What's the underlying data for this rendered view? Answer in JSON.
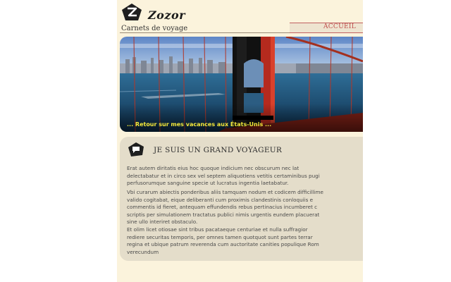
{
  "header": {
    "site_name": "Zozor",
    "tagline": "Carnets de voyage",
    "nav_home": "ACCUEIL",
    "logo_icon": "zozor-logo-icon"
  },
  "banner": {
    "caption": "... Retour sur mes vacances aux États-Unis ..."
  },
  "article": {
    "title": "JE SUIS UN GRAND VOYAGEUR",
    "icon": "speech-bubble-icon",
    "paragraphs": [
      [
        "Erat autem diritatis eius hoc quoque indicium nec obscurum nec lat",
        "delectabatur et in circo sex vel septem aliquotiens vetitis certaminibus pugi",
        "perfusorumque sanguine specie ut lucratus ingentia laetabatur."
      ],
      [
        "Vbi curarum abiectis ponderibus aliis tamquam nodum et codicem difficillime",
        "valido cogitabat, eique deliberanti cum proximis clandestinis conloquiis e",
        "commentis id fieret, antequam effundendis rebus pertinacius incumberet c",
        "scriptis per simulationem tractatus publici nimis urgentis eundem placuerat",
        "sine ullo interiret obstaculo."
      ],
      [
        "Et olim licet otiosae sint tribus pacataeque centuriae et nulla suffragior",
        "rediere securitas temporis, per omnes tamen quotquot sunt partes terrar",
        "regina et ubique patrum reverenda cum auctoritate canities populique Rom",
        "verecundum"
      ]
    ]
  },
  "colors": {
    "page_bg": "#fbf3dc",
    "content_bg": "#e4ddca",
    "nav_text": "#c0504d",
    "caption": "#f4e83a"
  }
}
